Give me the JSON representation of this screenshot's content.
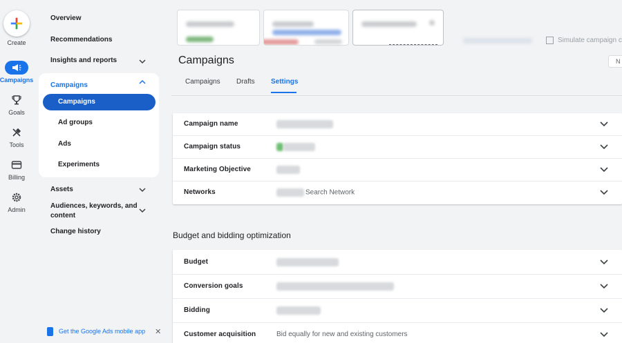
{
  "rail": {
    "create_label": "Create",
    "items": [
      {
        "label": "Campaigns",
        "icon": "megaphone-icon",
        "active": true
      },
      {
        "label": "Goals",
        "icon": "trophy-icon",
        "active": false
      },
      {
        "label": "Tools",
        "icon": "tools-icon",
        "active": false
      },
      {
        "label": "Billing",
        "icon": "credit-card-icon",
        "active": false
      },
      {
        "label": "Admin",
        "icon": "gear-icon",
        "active": false
      }
    ]
  },
  "sidenav": {
    "overview": "Overview",
    "recommendations": "Recommendations",
    "insights": "Insights and reports",
    "campaigns_group": "Campaigns",
    "sub_items": [
      "Campaigns",
      "Ad groups",
      "Ads",
      "Experiments"
    ],
    "assets": "Assets",
    "audiences_line1": "Audiences, keywords, and",
    "audiences_line2": "content",
    "change_history": "Change history",
    "mobile_app": "Get the Google Ads mobile app"
  },
  "toolbar": {
    "simulate": "Simulate campaign c"
  },
  "header": {
    "title": "Campaigns",
    "right_button": "N",
    "tabs": [
      "Campaigns",
      "Drafts",
      "Settings"
    ],
    "active_tab": "Settings"
  },
  "settings": {
    "campaign_name": {
      "label": "Campaign name"
    },
    "campaign_status": {
      "label": "Campaign status"
    },
    "marketing_objective": {
      "label": "Marketing Objective"
    },
    "networks": {
      "label": "Networks",
      "value": "Search Network"
    }
  },
  "budget_section": {
    "title": "Budget and bidding optimization",
    "budget": {
      "label": "Budget"
    },
    "conversion_goals": {
      "label": "Conversion goals"
    },
    "bidding": {
      "label": "Bidding"
    },
    "customer_acquisition": {
      "label": "Customer acquisition",
      "value": "Bid equally for new and existing customers"
    }
  },
  "colors": {
    "accent": "#1a73e8",
    "active_nav": "#1a5fc8",
    "background": "#f1f3f4"
  }
}
